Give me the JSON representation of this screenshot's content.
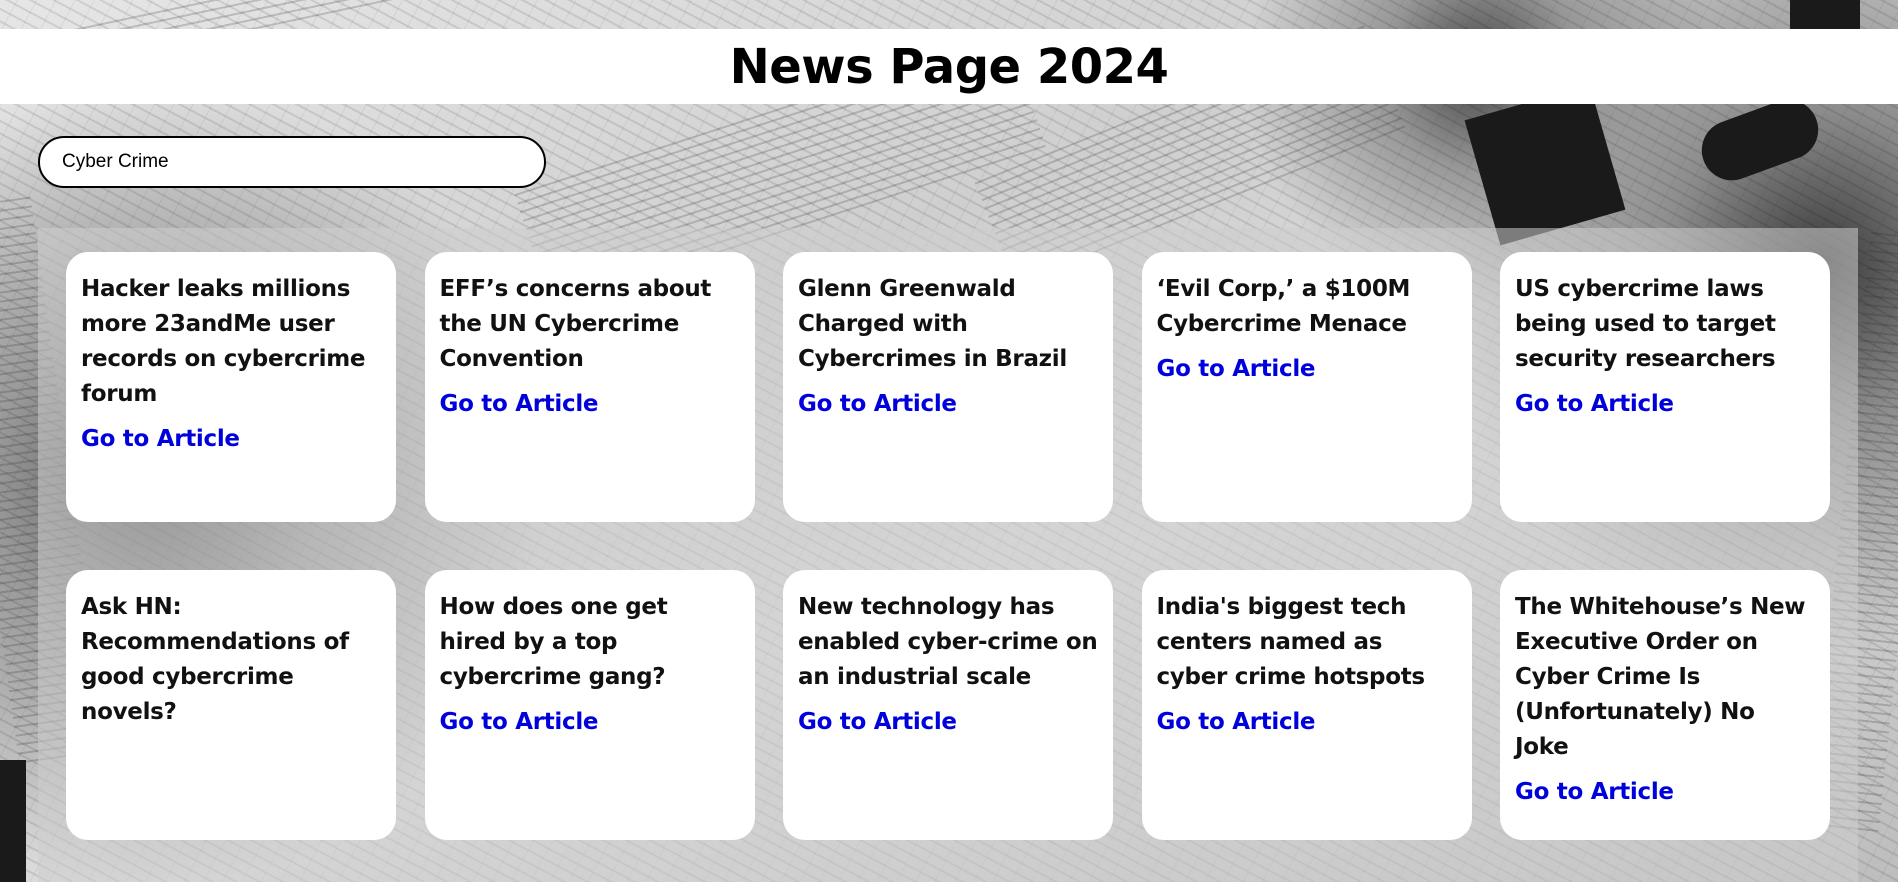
{
  "header": {
    "title": "News Page 2024"
  },
  "search": {
    "value": "Cyber Crime"
  },
  "articles": [
    {
      "title": "Hacker leaks millions more 23andMe user records on cybercrime forum",
      "link_label": "Go to Article"
    },
    {
      "title": "EFF’s concerns about the UN Cybercrime Convention",
      "link_label": "Go to Article"
    },
    {
      "title": "Glenn Greenwald Charged with Cybercrimes in Brazil",
      "link_label": "Go to Article"
    },
    {
      "title": "‘Evil Corp,’ a $100M Cybercrime Menace",
      "link_label": "Go to Article"
    },
    {
      "title": "US cybercrime laws being used to target security researchers",
      "link_label": "Go to Article"
    },
    {
      "title": "Ask HN: Recommendations of good cybercrime novels?",
      "link_label": ""
    },
    {
      "title": "How does one get hired by a top cybercrime gang?",
      "link_label": "Go to Article"
    },
    {
      "title": "New technology has enabled cyber-crime on an industrial scale",
      "link_label": "Go to Article"
    },
    {
      "title": "India's biggest tech centers named as cyber crime hotspots",
      "link_label": "Go to Article"
    },
    {
      "title": "The Whitehouse’s New Executive Order on Cyber Crime Is (Unfortunately) No Joke",
      "link_label": "Go to Article"
    }
  ],
  "colors": {
    "link": "#0000dd",
    "card_bg": "#ffffff",
    "header_bg": "#ffffff"
  }
}
